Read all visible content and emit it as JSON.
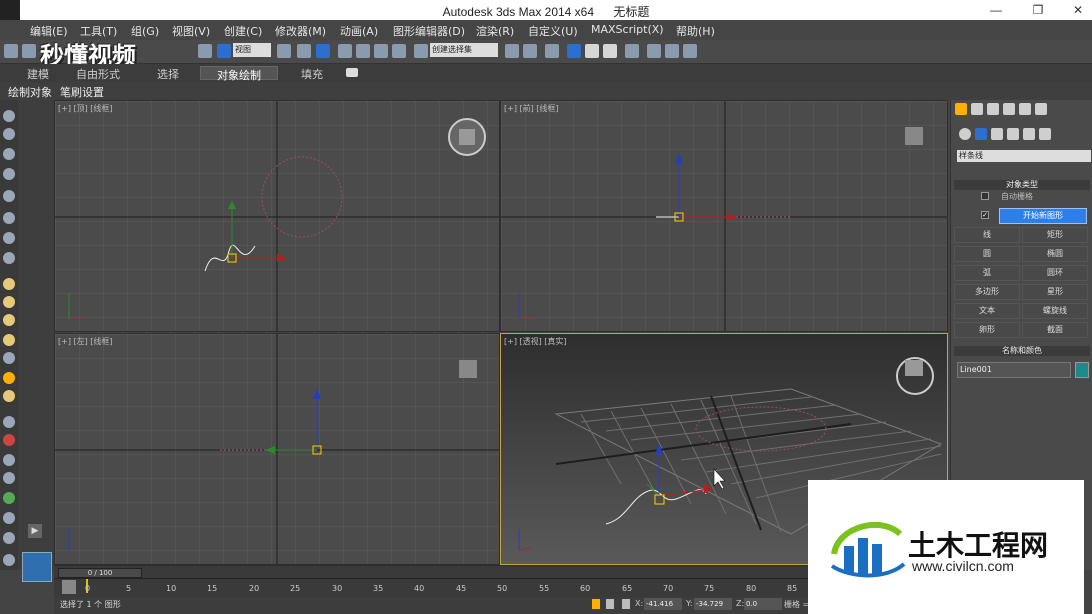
{
  "titlebar": {
    "app": "Autodesk 3ds Max  2014 x64",
    "doc": "无标题",
    "minimize": "—",
    "restore": "❐",
    "close": "✕"
  },
  "menu": [
    "编辑(E)",
    "工具(T)",
    "组(G)",
    "视图(V)",
    "创建(C)",
    "修改器(M)",
    "动画(A)",
    "图形编辑器(D)",
    "渲染(R)",
    "自定义(U)",
    "MAXScript(X)",
    "帮助(H)"
  ],
  "toolbar": {
    "view_select": "视图",
    "selection_set": "创建选择集"
  },
  "ribbon_tabs": [
    "建模",
    "自由形式",
    "选择",
    "对象绘制",
    "填充"
  ],
  "ribbon_active": "对象绘制",
  "subribbon": [
    "绘制对象",
    "笔刷设置"
  ],
  "viewports": [
    {
      "label": "[+] [顶] [线框]",
      "active": false
    },
    {
      "label": "[+] [前] [线框]",
      "active": false
    },
    {
      "label": "[+] [左] [线框]",
      "active": false
    },
    {
      "label": "[+] [透视] [真实]",
      "active": true
    }
  ],
  "command_panel": {
    "category_select": "样条线",
    "object_type_header": "对象类型",
    "auto_grid_label": "自动栅格",
    "start_new_shape": "开始新图形",
    "start_new_shape_checked": true,
    "buttons": [
      "线",
      "矩形",
      "圆",
      "椭圆",
      "弧",
      "圆环",
      "多边形",
      "星形",
      "文本",
      "螺旋线",
      "卵形",
      "截面"
    ],
    "name_color_header": "名称和颜色",
    "object_name": "Line001",
    "object_color": "#1a8a8a"
  },
  "timeline": {
    "frame_counter": "0 / 100",
    "ticks": [
      "0",
      "5",
      "10",
      "15",
      "20",
      "25",
      "30",
      "35",
      "40",
      "45",
      "50",
      "55",
      "60",
      "65",
      "70",
      "75",
      "80",
      "85"
    ]
  },
  "status": {
    "message": "选择了 1 个 图形",
    "x_label": "X:",
    "x_value": "-41.416",
    "y_label": "Y:",
    "y_value": "-34.729",
    "z_label": "Z:",
    "z_value": "0.0",
    "grid_label": "栅格 = 10"
  },
  "watermark": {
    "title": "土木工程网",
    "url": "www.civilcn.com"
  },
  "brand_overlay": "秒懂视频"
}
